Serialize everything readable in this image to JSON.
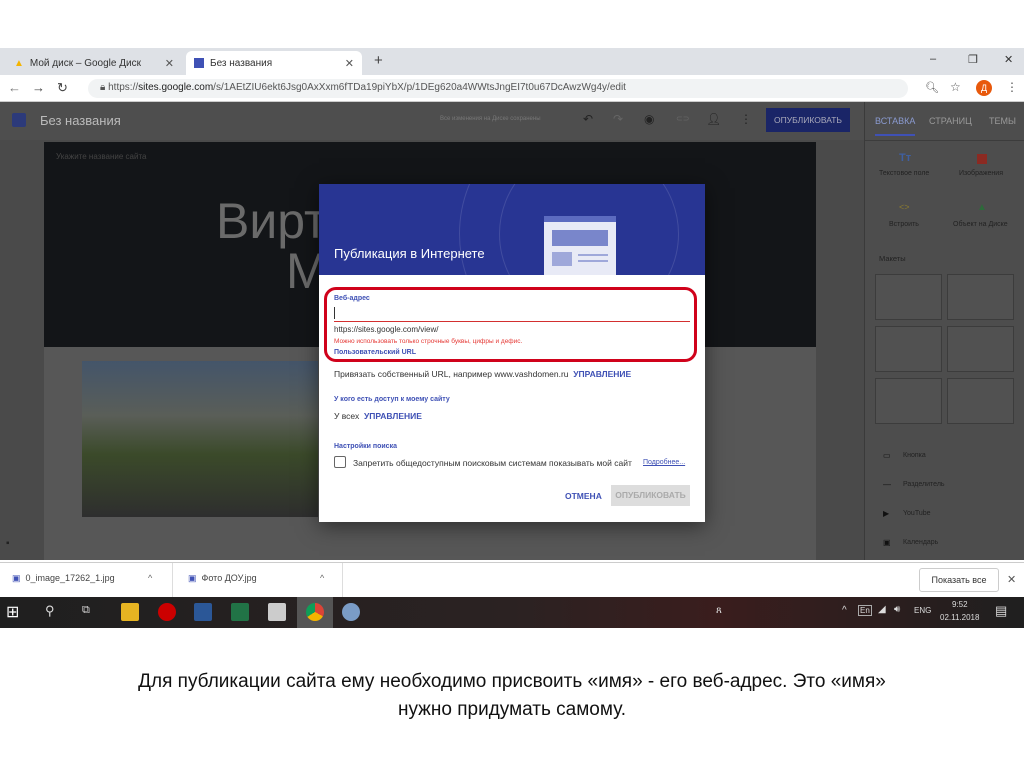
{
  "browser": {
    "tabs": [
      {
        "label": "Мой диск – Google Диск"
      },
      {
        "label": "Без названия"
      }
    ],
    "new_tab": "+",
    "url_prefix": "https://",
    "url_host": "sites.google.com",
    "url_path": "/s/1AEtZIU6ekt6Jsg0AxXxm6fTDa19piYbX/p/1DEg620a4WWtsJngEI7t0u67DcAwzWg4y/edit",
    "profile_initial": "Д"
  },
  "app": {
    "title": "Без названия",
    "saved_status": "Все изменения на Диске сохранены",
    "publish": "ОПУБЛИКОВАТЬ",
    "side_tabs": [
      "ВСТАВКА",
      "СТРАНИЦ",
      "ТЕМЫ"
    ],
    "insert_items": [
      "Текстовое поле",
      "Изображения",
      "Встроить",
      "Объект на Диске"
    ],
    "layouts_label": "Макеты",
    "components": [
      "Кнопка",
      "Разделитель",
      "YouTube",
      "Календарь"
    ],
    "site_name_placeholder": "Укажите название сайта",
    "hero_line1": "Вирт",
    "hero_line2": "М"
  },
  "dialog": {
    "title": "Публикация в Интернете",
    "web_address_label": "Веб-адрес",
    "web_address_value": "",
    "url_prefix": "https://sites.google.com/view/",
    "error": "Можно использовать только строчные буквы, цифры и дефис.",
    "custom_url_label": "Пользовательский URL",
    "custom_url_text": "Привязать собственный URL, например www.vashdomen.ru",
    "manage": "УПРАВЛЕНИЕ",
    "access_label": "У кого есть доступ к моему сайту",
    "access_value": "У всех",
    "search_label": "Настройки поиска",
    "search_checkbox": "Запретить общедоступным поисковым системам показывать мой сайт",
    "more": "Подробнее...",
    "cancel": "ОТМЕНА",
    "publish": "ОПУБЛИКОВАТЬ",
    "highlight_color": "#d0021b"
  },
  "downloads": {
    "items": [
      "0_image_17262_1.jpg",
      "Фото ДОУ.jpg"
    ],
    "show_all": "Показать все"
  },
  "taskbar": {
    "lang": "ENG",
    "time": "9:52",
    "date": "02.11.2018"
  },
  "caption": {
    "line1": "Для публикации сайта ему необходимо присвоить «имя» - его веб-адрес. Это «имя»",
    "line2": "нужно придумать самому."
  }
}
